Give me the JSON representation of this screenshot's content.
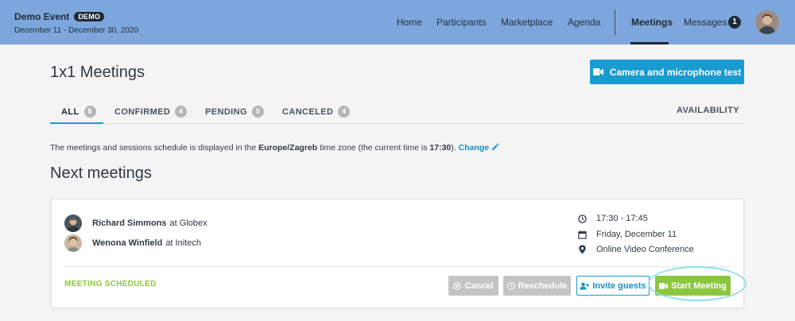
{
  "header": {
    "event_title": "Demo Event",
    "event_badge": "DEMO",
    "event_dates": "December 11 - December 30, 2020",
    "nav": [
      "Home",
      "Participants",
      "Marketplace",
      "Agenda",
      "Meetings",
      "Messages"
    ],
    "messages_count": "1"
  },
  "page": {
    "title": "1x1 Meetings",
    "camera_button": "Camera and microphone test"
  },
  "tabs": [
    {
      "label": "ALL",
      "count": "8"
    },
    {
      "label": "CONFIRMED",
      "count": "4"
    },
    {
      "label": "PENDING",
      "count": "0"
    },
    {
      "label": "CANCELED",
      "count": "4"
    }
  ],
  "availability": "AVAILABILITY",
  "timezone": {
    "prefix": "The meetings and sessions schedule is displayed in the",
    "zone": "Europe/Zagreb",
    "middle": "time zone (the current time is",
    "time": "17:30",
    "suffix": ").",
    "change": "Change"
  },
  "section_title": "Next meetings",
  "meeting": {
    "participants": [
      {
        "name": "Richard Simmons",
        "at": "at Globex"
      },
      {
        "name": "Wenona Winfield",
        "at": "at Initech"
      }
    ],
    "time": "17:30 - 17:45",
    "date": "Friday, December 11",
    "location": "Online Video Conference",
    "status": "MEETING SCHEDULED",
    "buttons": {
      "cancel": "Cancel",
      "reschedule": "Reschedule",
      "invite": "Invite guests",
      "start": "Start Meeting"
    }
  },
  "colors": {
    "header_bg": "#7da7dc",
    "accent_blue": "#1a9bd0",
    "accent_green": "#8cc63f"
  }
}
